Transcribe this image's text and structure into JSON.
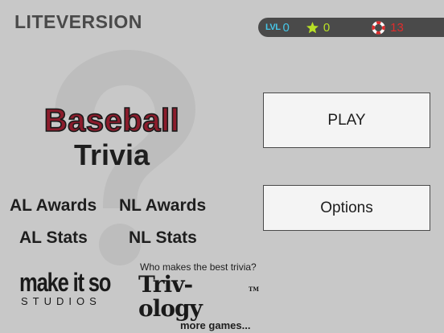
{
  "header": {
    "edition": "LITEVERSION"
  },
  "status": {
    "level_label": "LVL",
    "level_value": "0",
    "stars_value": "0",
    "lives_value": "13",
    "level_color": "#46c6e8",
    "star_color": "#b8e026",
    "lives_color": "#e02c2c"
  },
  "logo": {
    "line1": "Baseball",
    "line2": "Trivia"
  },
  "categories": {
    "al_awards": "AL Awards",
    "nl_awards": "NL Awards",
    "al_stats": "AL Stats",
    "nl_stats": "NL Stats"
  },
  "brands": {
    "studio_main": "make it so",
    "studio_sub": "STUDIOS",
    "tagline": "Who makes the best trivia?",
    "trivology": "Triv-ology",
    "trademark": "TM",
    "more_games": "more games..."
  },
  "menu": {
    "play": "PLAY",
    "options": "Options"
  },
  "icons": {
    "star": "star-icon",
    "lives": "life-ring-icon",
    "background": "question-mark-icon"
  }
}
